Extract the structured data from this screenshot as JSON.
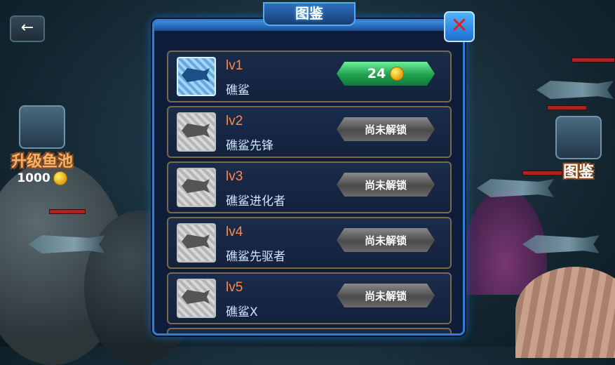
{
  "hud": {
    "upgrade_label": "升级鱼池",
    "upgrade_cost": "1000",
    "collection_label": "图鉴"
  },
  "modal": {
    "title": "图鉴",
    "items": [
      {
        "level": "lv1",
        "name": "礁鲨",
        "status": "unlocked",
        "price": "24"
      },
      {
        "level": "lv2",
        "name": "礁鲨先锋",
        "status": "locked",
        "button_label": "尚未解锁"
      },
      {
        "level": "lv3",
        "name": "礁鲨进化者",
        "status": "locked",
        "button_label": "尚未解锁"
      },
      {
        "level": "lv4",
        "name": "礁鲨先驱者",
        "status": "locked",
        "button_label": "尚未解锁"
      },
      {
        "level": "lv5",
        "name": "礁鲨X",
        "status": "locked",
        "button_label": "尚未解锁"
      }
    ]
  },
  "icons": {
    "back": "back-arrow-icon",
    "close": "close-x-icon",
    "coin": "gold-coin-icon"
  },
  "colors": {
    "panel_border": "#2f7fd8",
    "level_text": "#ff8a4a",
    "buy_button": "#1fa04e",
    "close_x": "#e02020"
  }
}
